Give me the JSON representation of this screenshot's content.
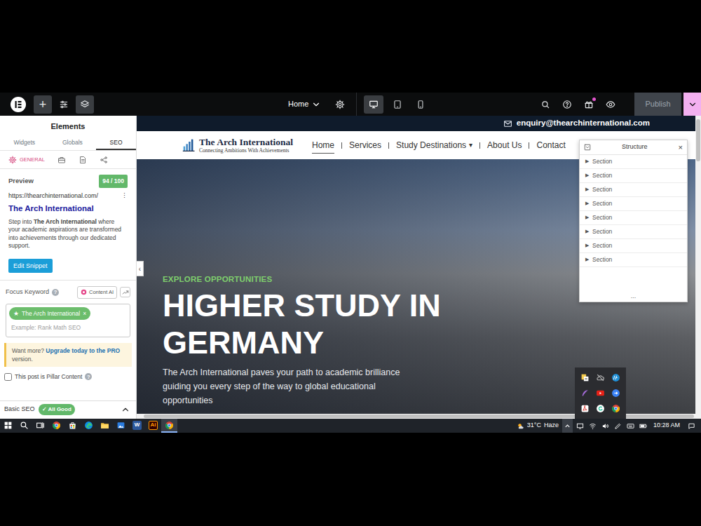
{
  "topbar": {
    "add": "+",
    "tools": [
      {
        "kind": "settings",
        "selected": false
      },
      {
        "kind": "structure",
        "selected": true
      }
    ],
    "page": "Home",
    "devices": [
      {
        "kind": "desktop",
        "selected": true
      },
      {
        "kind": "tablet",
        "selected": false
      },
      {
        "kind": "mobile",
        "selected": false
      }
    ],
    "actions": [
      {
        "kind": "search",
        "dot": false
      },
      {
        "kind": "help",
        "dot": false
      },
      {
        "kind": "whats-new",
        "dot": true
      },
      {
        "kind": "preview",
        "dot": false
      }
    ],
    "publish": {
      "label": "Publish",
      "disabled": true
    }
  },
  "panel": {
    "title": "Elements",
    "tabs": [
      {
        "label": "Widgets",
        "selected": false
      },
      {
        "label": "Globals",
        "selected": false
      },
      {
        "label": "SEO",
        "selected": true
      }
    ],
    "seo_tabs": [
      {
        "kind": "general",
        "label": "GENERAL",
        "selected": true
      },
      {
        "kind": "advanced",
        "selected": false
      },
      {
        "kind": "schema",
        "selected": false
      },
      {
        "kind": "social",
        "selected": false
      }
    ],
    "preview": {
      "label": "Preview",
      "score": "94 / 100",
      "url": "https://thearchinternational.com/",
      "menu": "⋮",
      "title": "The Arch International",
      "description_parts": [
        {
          "text": "Step into ",
          "bold": false
        },
        {
          "text": "The Arch International",
          "bold": true
        },
        {
          "text": " where your academic aspirations are transformed into achievements through our dedicated support.",
          "bold": false
        }
      ],
      "button": "Edit Snippet"
    },
    "focus_keyword": {
      "label": "Focus Keyword",
      "help": "?",
      "content_ai": "Content AI",
      "keywords": [
        {
          "star": "★",
          "text": "The Arch International",
          "remove": "×"
        }
      ],
      "placeholder": "Example: Rank Math SEO"
    },
    "notice": {
      "text": "Want more? ",
      "link": "Upgrade today to the PRO",
      "tail": " version."
    },
    "pillar": {
      "label": "This post is Pillar Content",
      "checked": false,
      "help": "?"
    },
    "basic_seo": {
      "label": "Basic SEO",
      "badge": "✓ All Good",
      "expanded": true
    },
    "collapse": "‹"
  },
  "site": {
    "email": "enquiry@thearchinternational.com",
    "logo": {
      "name": "The Arch International",
      "tagline": "Connecting Ambitions With Achievements"
    },
    "menu": [
      {
        "label": "Home",
        "selected": true
      },
      {
        "label": "Services",
        "selected": false
      },
      {
        "label": "Study Destinations",
        "selected": false,
        "caret": "▾"
      },
      {
        "label": "About Us",
        "selected": false
      },
      {
        "label": "Contact",
        "selected": false
      }
    ],
    "hero": {
      "kicker": "EXPLORE OPPORTUNITIES",
      "title": "HIGHER STUDY IN GERMANY",
      "text": "The Arch International paves your path to academic brilliance guiding you every step of the way to global educational opportunities"
    }
  },
  "structure": {
    "title": "Structure",
    "close": "×",
    "items": [
      {
        "label": "Section",
        "expanded": false
      },
      {
        "label": "Section",
        "expanded": false
      },
      {
        "label": "Section",
        "expanded": false
      },
      {
        "label": "Section",
        "expanded": false
      },
      {
        "label": "Section",
        "expanded": false
      },
      {
        "label": "Section",
        "expanded": false
      },
      {
        "label": "Section",
        "expanded": false
      },
      {
        "label": "Section",
        "expanded": false
      }
    ],
    "footer": "..."
  },
  "tray_popup": {
    "icons": [
      {
        "kind": "sync"
      },
      {
        "kind": "cloud-off"
      },
      {
        "kind": "hp"
      },
      {
        "kind": "feather"
      },
      {
        "kind": "youtube"
      },
      {
        "kind": "remote"
      },
      {
        "kind": "acrobat"
      },
      {
        "kind": "grammarly"
      },
      {
        "kind": "chrome"
      }
    ]
  },
  "taskbar": {
    "apps": [
      {
        "kind": "windows",
        "running": false
      },
      {
        "kind": "search",
        "running": false
      },
      {
        "kind": "taskview",
        "running": false
      },
      {
        "kind": "chrome",
        "running": false
      },
      {
        "kind": "store",
        "running": false
      },
      {
        "kind": "edge",
        "running": false
      },
      {
        "kind": "explorer",
        "running": false
      },
      {
        "kind": "photos",
        "running": false
      },
      {
        "kind": "word",
        "glyph": "W",
        "running": false
      },
      {
        "kind": "illustrator",
        "glyph": "Ai",
        "running": false
      },
      {
        "kind": "chrome",
        "running": true
      }
    ],
    "weather": {
      "temp": "31°C",
      "condition": "Haze"
    },
    "tray_expanded": true,
    "tray": [
      {
        "kind": "display"
      },
      {
        "kind": "network"
      },
      {
        "kind": "volume"
      },
      {
        "kind": "pen"
      },
      {
        "kind": "keyboard"
      },
      {
        "kind": "battery"
      }
    ],
    "time": "10:28 AM"
  }
}
